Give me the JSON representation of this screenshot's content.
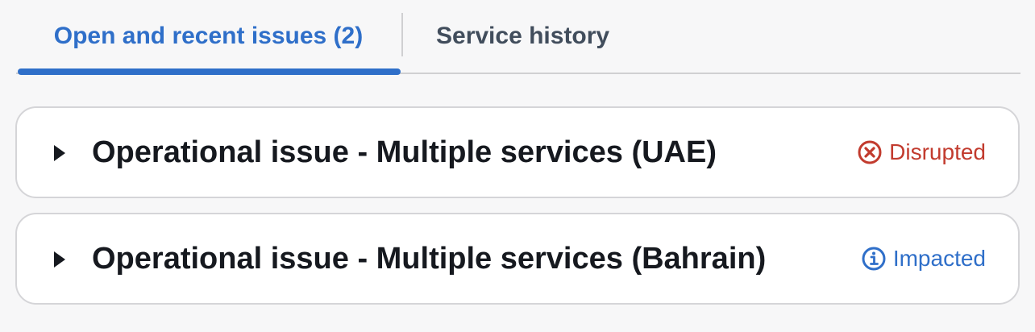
{
  "tabs": [
    {
      "label": "Open and recent issues (2)",
      "active": true
    },
    {
      "label": "Service history",
      "active": false
    }
  ],
  "issues": [
    {
      "title": "Operational issue - Multiple services (UAE)",
      "status": "Disrupted",
      "status_icon": "error-circle-icon",
      "status_color": "#c23b2e"
    },
    {
      "title": "Operational issue - Multiple services (Bahrain)",
      "status": "Impacted",
      "status_icon": "info-circle-icon",
      "status_color": "#2f6fc9"
    }
  ],
  "colors": {
    "accent": "#2f6fc9",
    "text": "#16191f",
    "border": "#d5d5d8"
  }
}
